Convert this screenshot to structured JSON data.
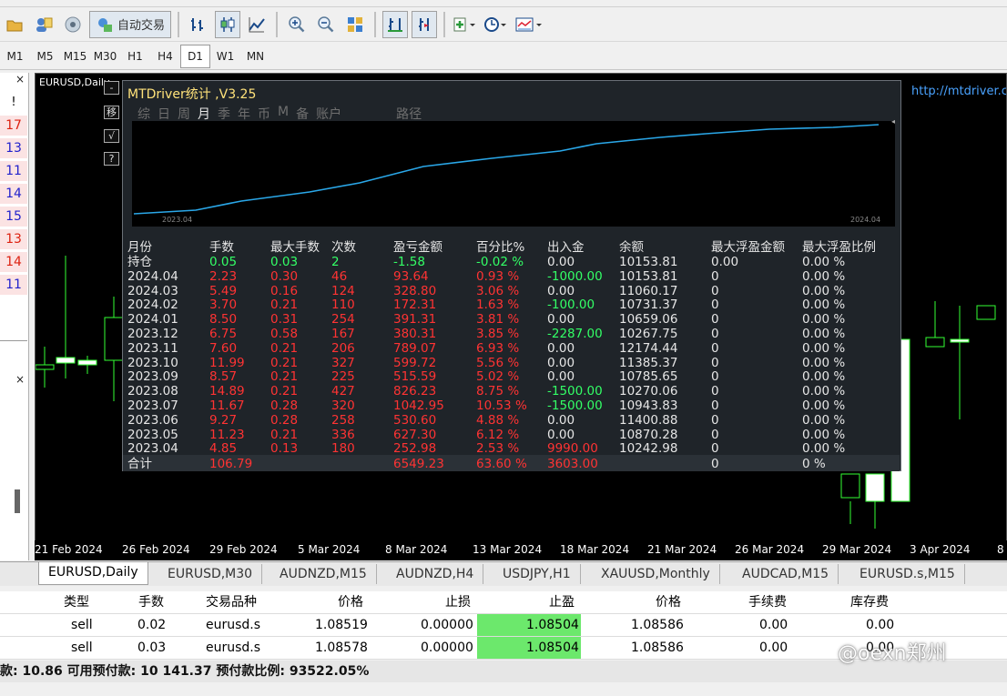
{
  "toolbar": {
    "autotrade_label": "自动交易"
  },
  "timeframes": [
    "M1",
    "M5",
    "M15",
    "M30",
    "H1",
    "H4",
    "D1",
    "W1",
    "MN"
  ],
  "left_panel": {
    "close_top": "×",
    "exclaim": "!",
    "numbers": [
      "17",
      "13",
      "11",
      "14",
      "15",
      "13",
      "14",
      "11"
    ],
    "close_bottom": "×"
  },
  "chart": {
    "title": "EURUSD,Daily",
    "link": "http://mtdriver.cn",
    "x_labels": [
      "21 Feb 2024",
      "26 Feb 2024",
      "29 Feb 2024",
      "5 Mar 2024",
      "8 Mar 2024",
      "13 Mar 2024",
      "18 Mar 2024",
      "21 Mar 2024",
      "26 Mar 2024",
      "29 Mar 2024",
      "3 Apr 2024",
      "8"
    ]
  },
  "mtdriver": {
    "title": "MTDriver统计 ,V3.25",
    "side_buttons": [
      "-",
      "移",
      "√",
      "?"
    ],
    "tabs": [
      "综",
      "日",
      "周",
      "月",
      "季",
      "年",
      "币",
      "M",
      "备",
      "账户",
      "",
      "",
      "",
      "路径"
    ],
    "active_tab": "月",
    "equity_start_label": "2023.04",
    "equity_end_label": "2024.04",
    "headers": [
      "月份",
      "手数",
      "最大手数",
      "次数",
      "盈亏金额",
      "百分比%",
      "出入金",
      "余额",
      "最大浮盈金额",
      "最大浮盈比例"
    ],
    "rows": [
      {
        "month": "持仓",
        "lots": "0.05",
        "max_lots": "0.03",
        "count": "2",
        "pnl": "-1.58",
        "pct": "-0.02 %",
        "flow": "0.00",
        "balance": "10153.81",
        "max_float": "0.00",
        "max_float_pct": "0.00 %"
      },
      {
        "month": "2024.04",
        "lots": "2.23",
        "max_lots": "0.30",
        "count": "46",
        "pnl": "93.64",
        "pct": "0.93 %",
        "flow": "-1000.00",
        "balance": "10153.81",
        "max_float": "0",
        "max_float_pct": "0.00 %"
      },
      {
        "month": "2024.03",
        "lots": "5.49",
        "max_lots": "0.16",
        "count": "124",
        "pnl": "328.80",
        "pct": "3.06 %",
        "flow": "0.00",
        "balance": "11060.17",
        "max_float": "0",
        "max_float_pct": "0.00 %"
      },
      {
        "month": "2024.02",
        "lots": "3.70",
        "max_lots": "0.21",
        "count": "110",
        "pnl": "172.31",
        "pct": "1.63 %",
        "flow": "-100.00",
        "balance": "10731.37",
        "max_float": "0",
        "max_float_pct": "0.00 %"
      },
      {
        "month": "2024.01",
        "lots": "8.50",
        "max_lots": "0.31",
        "count": "254",
        "pnl": "391.31",
        "pct": "3.81 %",
        "flow": "0.00",
        "balance": "10659.06",
        "max_float": "0",
        "max_float_pct": "0.00 %"
      },
      {
        "month": "2023.12",
        "lots": "6.75",
        "max_lots": "0.58",
        "count": "167",
        "pnl": "380.31",
        "pct": "3.85 %",
        "flow": "-2287.00",
        "balance": "10267.75",
        "max_float": "0",
        "max_float_pct": "0.00 %"
      },
      {
        "month": "2023.11",
        "lots": "7.60",
        "max_lots": "0.21",
        "count": "206",
        "pnl": "789.07",
        "pct": "6.93 %",
        "flow": "0.00",
        "balance": "12174.44",
        "max_float": "0",
        "max_float_pct": "0.00 %"
      },
      {
        "month": "2023.10",
        "lots": "11.99",
        "max_lots": "0.21",
        "count": "327",
        "pnl": "599.72",
        "pct": "5.56 %",
        "flow": "0.00",
        "balance": "11385.37",
        "max_float": "0",
        "max_float_pct": "0.00 %"
      },
      {
        "month": "2023.09",
        "lots": "8.57",
        "max_lots": "0.21",
        "count": "225",
        "pnl": "515.59",
        "pct": "5.02 %",
        "flow": "0.00",
        "balance": "10785.65",
        "max_float": "0",
        "max_float_pct": "0.00 %"
      },
      {
        "month": "2023.08",
        "lots": "14.89",
        "max_lots": "0.21",
        "count": "427",
        "pnl": "826.23",
        "pct": "8.75 %",
        "flow": "-1500.00",
        "balance": "10270.06",
        "max_float": "0",
        "max_float_pct": "0.00 %"
      },
      {
        "month": "2023.07",
        "lots": "11.67",
        "max_lots": "0.28",
        "count": "320",
        "pnl": "1042.95",
        "pct": "10.53 %",
        "flow": "-1500.00",
        "balance": "10943.83",
        "max_float": "0",
        "max_float_pct": "0.00 %"
      },
      {
        "month": "2023.06",
        "lots": "9.27",
        "max_lots": "0.28",
        "count": "258",
        "pnl": "530.60",
        "pct": "4.88 %",
        "flow": "0.00",
        "balance": "11400.88",
        "max_float": "0",
        "max_float_pct": "0.00 %"
      },
      {
        "month": "2023.05",
        "lots": "11.23",
        "max_lots": "0.21",
        "count": "336",
        "pnl": "627.30",
        "pct": "6.12 %",
        "flow": "0.00",
        "balance": "10870.28",
        "max_float": "0",
        "max_float_pct": "0.00 %"
      },
      {
        "month": "2023.04",
        "lots": "4.85",
        "max_lots": "0.13",
        "count": "180",
        "pnl": "252.98",
        "pct": "2.53 %",
        "flow": "9990.00",
        "balance": "10242.98",
        "max_float": "0",
        "max_float_pct": "0.00 %"
      }
    ],
    "total": {
      "month": "合计",
      "lots": "106.79",
      "pnl": "6549.23",
      "pct": "63.60 %",
      "flow": "3603.00",
      "max_float": "0",
      "max_float_pct": "0 %"
    }
  },
  "chart_tabs": [
    "EURUSD,Daily",
    "EURUSD,M30",
    "AUDNZD,M15",
    "AUDNZD,H4",
    "USDJPY,H1",
    "XAUUSD,Monthly",
    "AUDCAD,M15",
    "EURUSD.s,M15"
  ],
  "active_chart_tab": "EURUSD,Daily",
  "trade_table": {
    "headers": [
      "类型",
      "手数",
      "交易品种",
      "价格",
      "止损",
      "止盈",
      "价格",
      "手续费",
      "库存费"
    ],
    "rows": [
      {
        "type": "sell",
        "lots": "0.02",
        "symbol": "eurusd.s",
        "price": "1.08519",
        "sl": "0.00000",
        "tp": "1.08504",
        "cur": "1.08586",
        "commission": "0.00",
        "swap": "0.00"
      },
      {
        "type": "sell",
        "lots": "0.03",
        "symbol": "eurusd.s",
        "price": "1.08578",
        "sl": "0.00000",
        "tp": "1.08504",
        "cur": "1.08586",
        "commission": "0.00",
        "swap": "0.00"
      }
    ]
  },
  "status_bar": "款: 10.86  可用预付款: 10 141.37  预付款比例: 93522.05%",
  "watermark": "@oexn郑州",
  "colors": {
    "profit_red": "#ff3333",
    "profit_green": "#33ff66",
    "title_yellow": "#ffe27a",
    "tp_green": "#6ce86c"
  }
}
